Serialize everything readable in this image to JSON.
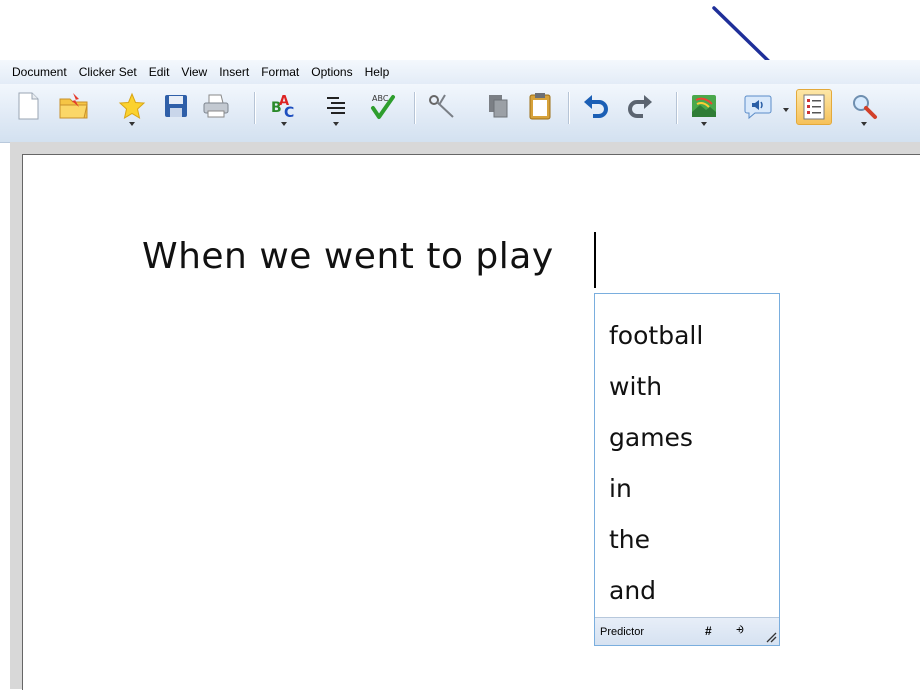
{
  "menu": {
    "items": [
      "Document",
      "Clicker Set",
      "Edit",
      "View",
      "Insert",
      "Format",
      "Options",
      "Help"
    ]
  },
  "toolbar": {
    "buttons": [
      "new-document-icon",
      "open-folder-icon",
      "favourites-star-icon",
      "save-icon",
      "print-icon",
      "font-style-icon",
      "line-spacing-icon",
      "spell-check-icon",
      "cut-icon",
      "copy-icon",
      "paste-icon",
      "undo-icon",
      "redo-icon",
      "insert-picture-icon",
      "speech-icon",
      "predictor-toggle-icon",
      "zoom-icon"
    ],
    "active_button": "predictor-toggle-icon"
  },
  "document": {
    "text": "When we went to play"
  },
  "predictor": {
    "words": [
      "football",
      "with",
      "games",
      "in",
      "the",
      "and"
    ],
    "footer_label": "Predictor",
    "hash_label": "#",
    "collapse_label": "⨮"
  },
  "colors": {
    "arrow": "#1f2f99",
    "active_button": "#f6c15a",
    "predictor_border": "#7aaede"
  }
}
